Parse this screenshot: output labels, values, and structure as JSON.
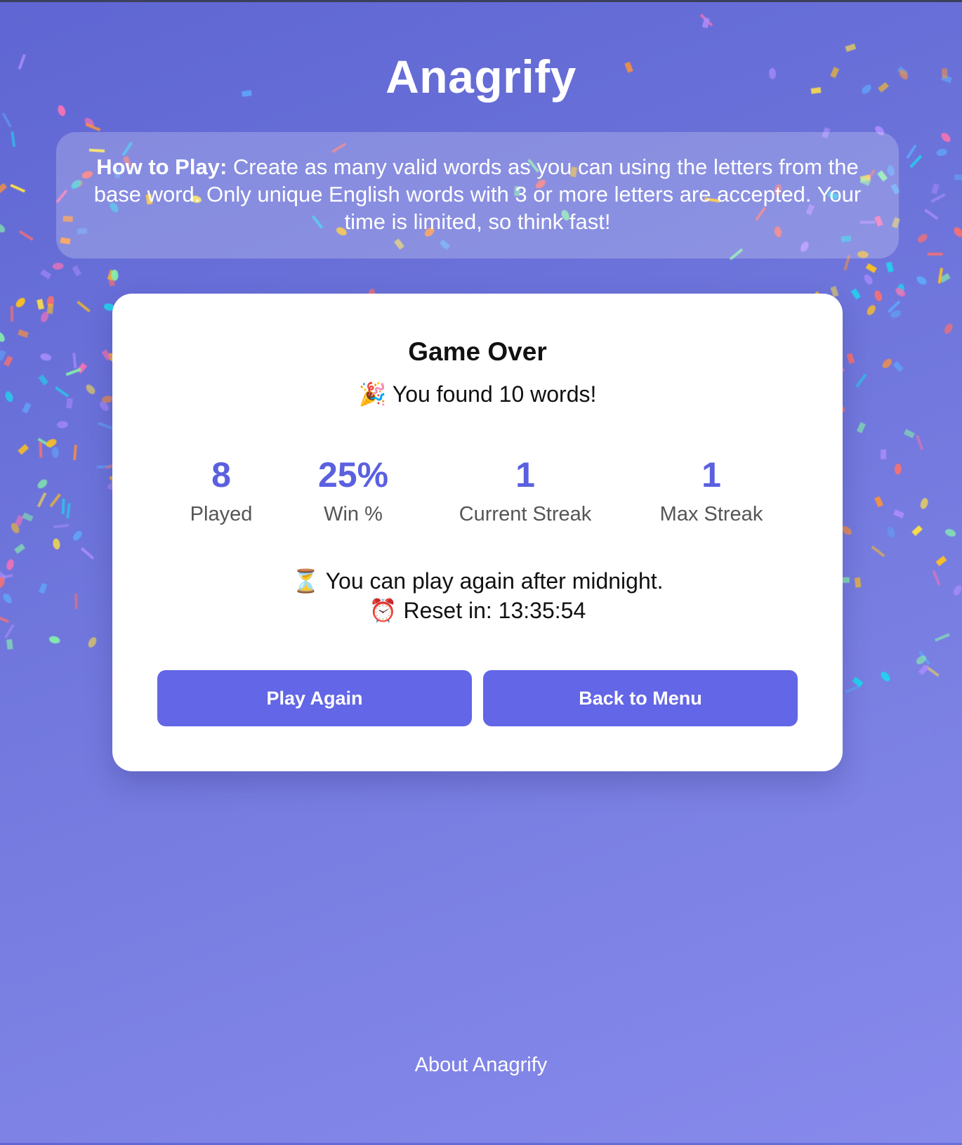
{
  "app": {
    "title": "Anagrify"
  },
  "howto": {
    "label": "How to Play:",
    "text": "Create as many valid words as you can using the letters from the base word. Only unique English words with 3 or more letters are accepted. Your time is limited, so think fast!"
  },
  "result": {
    "title": "Game Over",
    "found_text": "🎉 You found 10 words!",
    "stats": [
      {
        "value": "8",
        "label": "Played"
      },
      {
        "value": "25%",
        "label": "Win %"
      },
      {
        "value": "1",
        "label": "Current Streak"
      },
      {
        "value": "1",
        "label": "Max Streak"
      }
    ],
    "play_again_notice": "⏳ You can play again after midnight.",
    "reset_text": "⏰ Reset in: 13:35:54"
  },
  "buttons": {
    "play_again": "Play Again",
    "back_to_menu": "Back to Menu"
  },
  "footer": {
    "about_link": "About Anagrify"
  },
  "colors": {
    "accent": "#6366e6",
    "stat_number": "#5b60e0",
    "confetti": [
      "#f87171",
      "#fbbf24",
      "#a78bfa",
      "#60a5fa",
      "#86efac",
      "#fde047",
      "#fb923c",
      "#f472b6",
      "#22d3ee"
    ]
  }
}
